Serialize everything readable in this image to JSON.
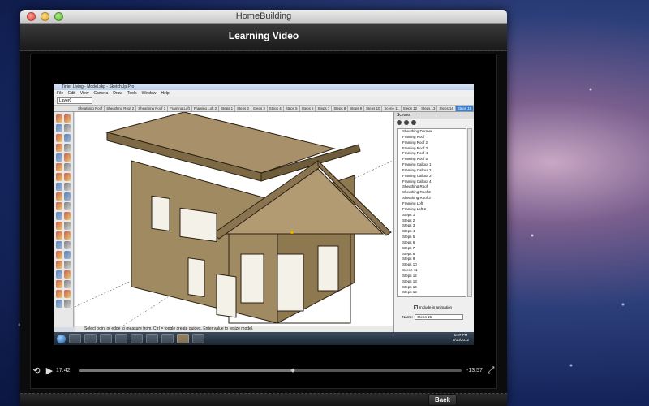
{
  "window": {
    "title": "HomeBuilding"
  },
  "header": {
    "title": "Learning Video"
  },
  "sketchup": {
    "title": "Tinier Living - Model.skp - SketchUp Pro",
    "menu": [
      "File",
      "Edit",
      "View",
      "Camera",
      "Draw",
      "Tools",
      "Window",
      "Help"
    ],
    "layer": "Layer0",
    "tabs": [
      "Sheathing Roof",
      "Sheathing Roof 2",
      "Sheathing Roof 3",
      "Framing Loft",
      "Framing Loft 2",
      "Steps 1",
      "Steps 2",
      "Steps 3",
      "Steps 4",
      "Steps 5",
      "Steps 6",
      "Steps 7",
      "Steps 8",
      "Steps 9",
      "Steps 10",
      "Scene 11",
      "Steps 12",
      "Steps 13",
      "Steps 14",
      "Steps 15"
    ],
    "active_tab": "Steps 15",
    "scenes_panel": {
      "title": "Scenes",
      "items": [
        "Sheathing Dormer",
        "Framing Roof",
        "Framing Roof 2",
        "Framing Roof 3",
        "Framing Roof 4",
        "Framing Roof 5",
        "Framing Callout 1",
        "Framing Callout 2",
        "Framing Callout 3",
        "Framing Callout 4",
        "Sheathing Roof",
        "Sheathing Roof 2",
        "Sheathing Roof 3",
        "Framing Loft",
        "Framing Loft 2",
        "Steps 1",
        "Steps 2",
        "Steps 3",
        "Steps 4",
        "Steps 5",
        "Steps 6",
        "Steps 7",
        "Steps 8",
        "Steps 9",
        "Steps 10",
        "Scene 11",
        "Steps 12",
        "Steps 13",
        "Steps 14",
        "Steps 15"
      ],
      "include_label": "Include in animation",
      "name_label": "Name:",
      "name_value": "Steps 15"
    },
    "status_text": "Select point or edge to measure from.  Ctrl = toggle create guides.  Enter value to resize model.",
    "clock_time": "1:27 PM",
    "clock_date": "8/10/2012"
  },
  "player": {
    "elapsed": "17:42",
    "remaining": "-13:57",
    "progress": 0.56,
    "replay_icon": "replay-icon",
    "play_icon": "play-icon",
    "fullscreen_icon": "fullscreen-icon"
  },
  "footer": {
    "back_label": "Back"
  }
}
